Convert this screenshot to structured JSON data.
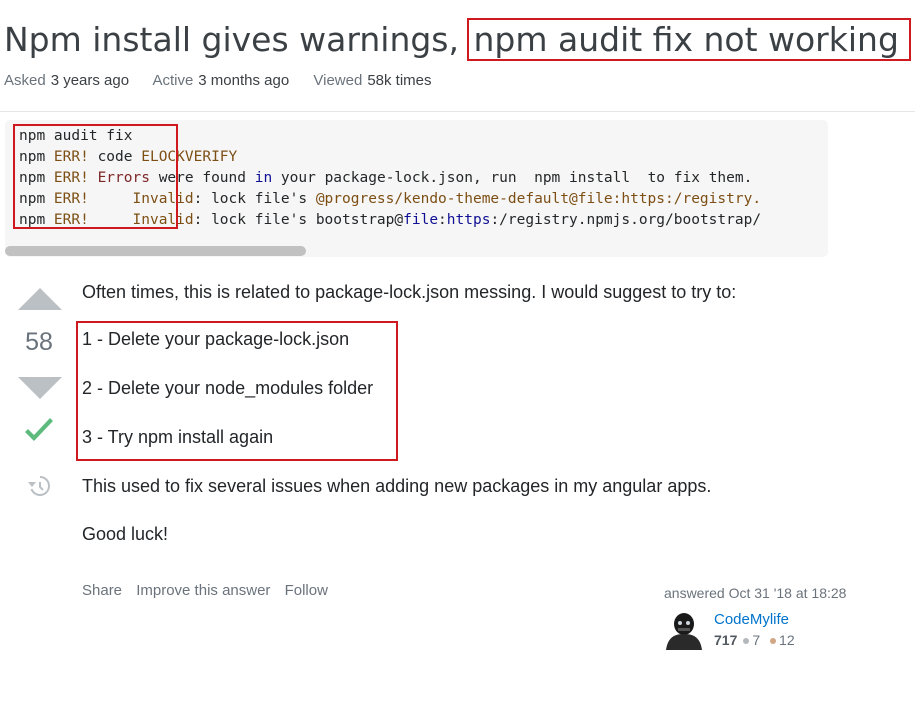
{
  "question": {
    "title_part1": "Npm install gives warnings, ",
    "title_part2": "npm audit fix not working",
    "asked_label": "Asked",
    "asked_value": "3 years ago",
    "active_label": "Active",
    "active_value": "3 months ago",
    "viewed_label": "Viewed",
    "viewed_value": "58k times"
  },
  "code": {
    "line1": "npm audit fix",
    "line2_a": "npm ",
    "line2_b": "ERR!",
    "line2_c": " code ",
    "line2_d": "ELOCKVERIFY",
    "line3_a": "npm ",
    "line3_b": "ERR!",
    "line3_c": " ",
    "line3_d": "Errors",
    "line3_e": " were found ",
    "line3_f": "in",
    "line3_g": " your package-lock.json, run  npm install  to fix them.",
    "line4_a": "npm ",
    "line4_b": "ERR!",
    "line4_c": "     ",
    "line4_d": "Invalid",
    "line4_e": ": lock file's ",
    "line4_f": "@progress/kendo-theme-default@file:https:/registry.",
    "line5_a": "npm ",
    "line5_b": "ERR!",
    "line5_c": "     ",
    "line5_d": "Invalid",
    "line5_e": ": lock file's bootstrap@",
    "line5_f": "file",
    "line5_g": ":",
    "line5_h": "https",
    "line5_i": ":/registry.npmjs.org/bootstrap/"
  },
  "answer": {
    "vote_count": "58",
    "intro": "Often times, this is related to package-lock.json messing. I would suggest to try to:",
    "step1": "1 - Delete your package-lock.json",
    "step2": "2 - Delete your node_modules folder",
    "step3": "3 - Try npm install again",
    "outro": "This used to fix several issues when adding new packages in my angular apps.",
    "closing": "Good luck!",
    "share": "Share",
    "improve": "Improve this answer",
    "follow": "Follow",
    "answered_label": "answered Oct 31 '18 at 18:28",
    "user_name": "CodeMylife",
    "reputation": "717",
    "silver_badges": "7",
    "bronze_badges": "12"
  },
  "colors": {
    "highlight_border": "#d0191f",
    "vote_arrow": "#bbc0c4",
    "accepted_check": "#5eba7d",
    "silver": "#b4b8bc",
    "bronze": "#d1a684"
  }
}
